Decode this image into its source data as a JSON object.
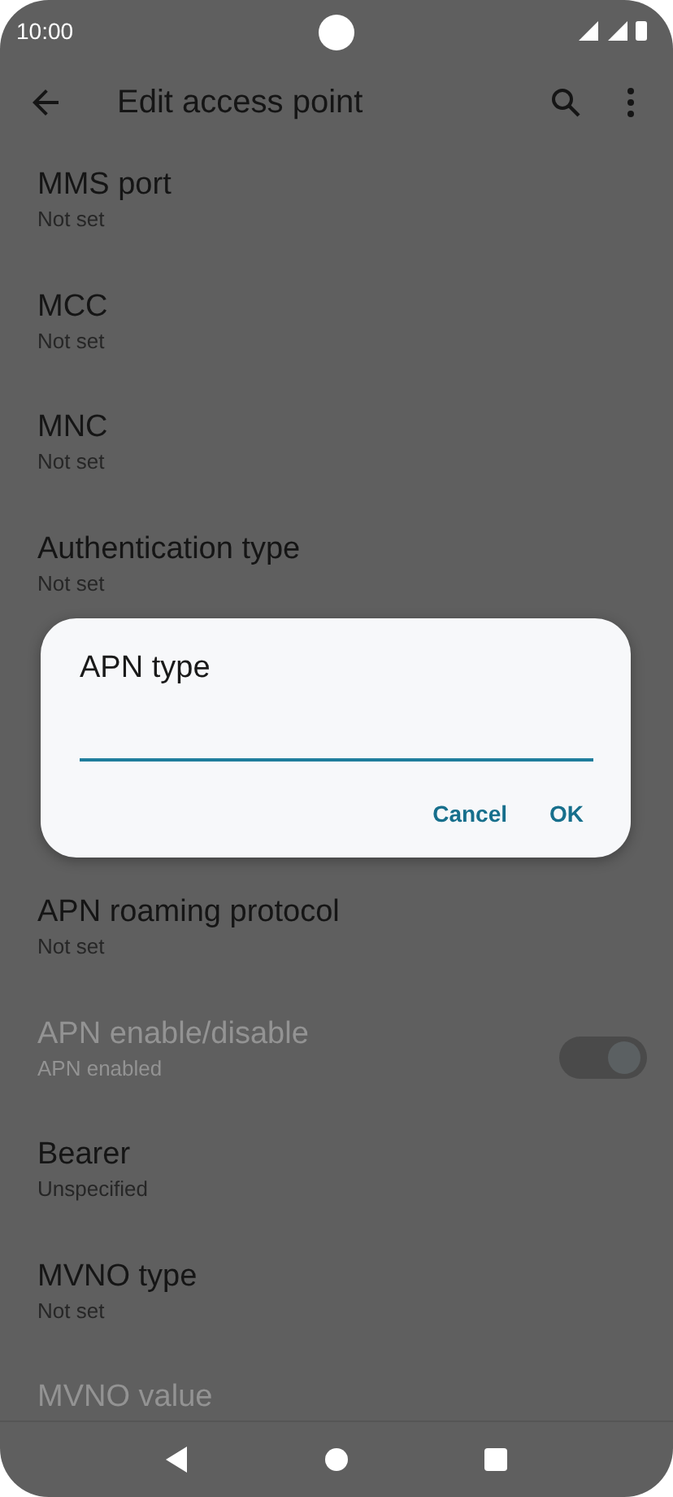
{
  "status_bar": {
    "time": "10:00"
  },
  "app_bar": {
    "title": "Edit access point"
  },
  "settings": [
    {
      "kind": "text",
      "title": "MMS port",
      "subtitle": "Not set",
      "disabled": false
    },
    {
      "kind": "text",
      "title": "MCC",
      "subtitle": "Not set",
      "disabled": false
    },
    {
      "kind": "text",
      "title": "MNC",
      "subtitle": "Not set",
      "disabled": false
    },
    {
      "kind": "text",
      "title": "Authentication type",
      "subtitle": "Not set",
      "disabled": false
    },
    {
      "kind": "text",
      "title": "APN roaming protocol",
      "subtitle": "Not set",
      "disabled": false
    },
    {
      "kind": "switch",
      "title": "APN enable/disable",
      "subtitle": "APN enabled",
      "disabled": true,
      "on": true
    },
    {
      "kind": "text",
      "title": "Bearer",
      "subtitle": "Unspecified",
      "disabled": false
    },
    {
      "kind": "text",
      "title": "MVNO type",
      "subtitle": "Not set",
      "disabled": false
    },
    {
      "kind": "text",
      "title": "MVNO value",
      "disabled": true
    }
  ],
  "dialog": {
    "title": "APN type",
    "buttons": [
      "Cancel",
      "OK"
    ]
  }
}
